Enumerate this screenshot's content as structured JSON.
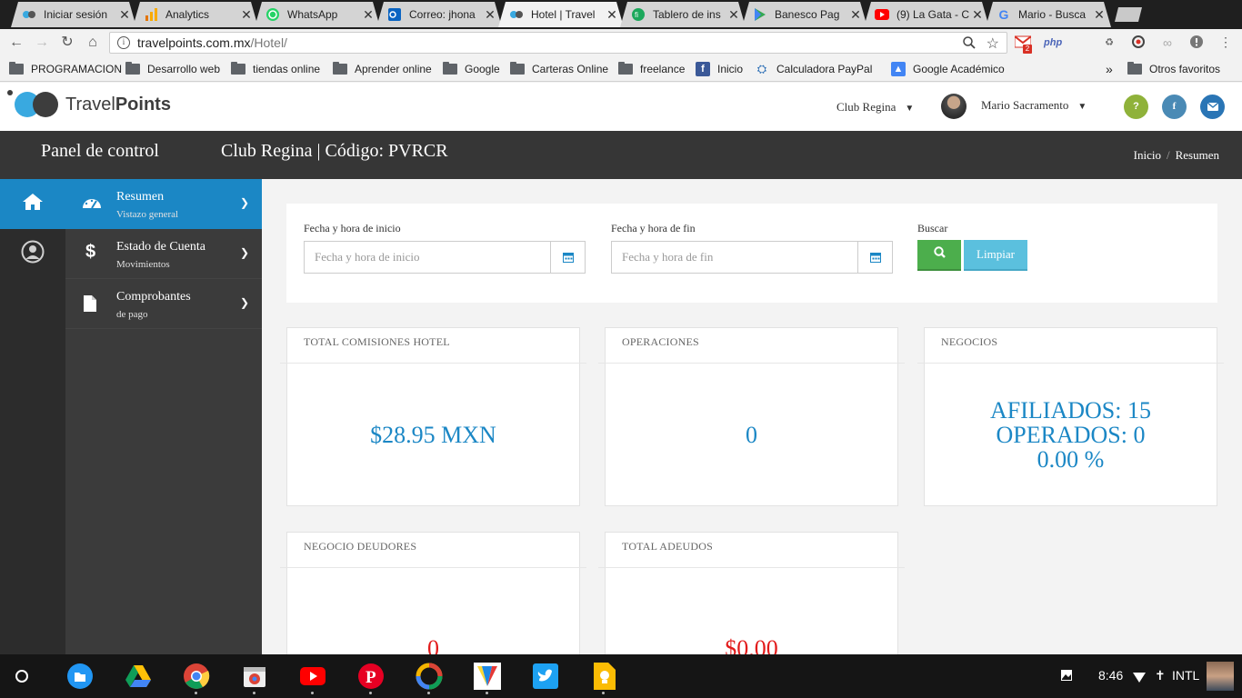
{
  "browser": {
    "tabs": [
      {
        "label": "Iniciar sesión",
        "icon": "travelpoints-icon",
        "active": false
      },
      {
        "label": "Analytics",
        "icon": "analytics-icon",
        "active": false
      },
      {
        "label": "WhatsApp",
        "icon": "whatsapp-icon",
        "active": false
      },
      {
        "label": "Correo: jhona",
        "icon": "outlook-icon",
        "active": false
      },
      {
        "label": "Hotel | Travel",
        "icon": "travelpoints-icon",
        "active": true
      },
      {
        "label": "Tablero de ins",
        "icon": "fi-icon",
        "active": false
      },
      {
        "label": "Banesco Pag",
        "icon": "play-store-icon",
        "active": false
      },
      {
        "label": "(9) La Gata - C",
        "icon": "youtube-icon",
        "active": false
      },
      {
        "label": "Mario - Busca",
        "icon": "google-icon",
        "active": false
      }
    ],
    "url_host": "travelpoints.com.mx",
    "url_path": "/Hotel/",
    "ext_badge": "2",
    "ext_php": "php",
    "bookmarks": [
      {
        "label": "PROGRAMACION",
        "type": "folder"
      },
      {
        "label": "Desarrollo web",
        "type": "folder"
      },
      {
        "label": "tiendas online",
        "type": "folder"
      },
      {
        "label": "Aprender online",
        "type": "folder"
      },
      {
        "label": "Google",
        "type": "folder"
      },
      {
        "label": "Carteras Online",
        "type": "folder"
      },
      {
        "label": "freelance",
        "type": "folder"
      },
      {
        "label": "Inicio",
        "type": "facebook"
      },
      {
        "label": "Calculadora PayPal",
        "type": "link"
      },
      {
        "label": "Google Académico",
        "type": "scholar"
      }
    ],
    "bookmarks_overflow": "»",
    "other_bookmarks": "Otros favoritos"
  },
  "header": {
    "logo_light": "Travel",
    "logo_bold": "Points",
    "club_select": "Club Regina",
    "user_name": "Mario Sacramento",
    "help_label": "?",
    "facebook_label": "f",
    "colors": {
      "help": "#8fb23a",
      "facebook": "#4a8ab5",
      "mail": "#2a75b5"
    }
  },
  "pagebar": {
    "title": "Panel de control",
    "subtitle": "Club Regina | Código: PVRCR",
    "breadcrumb_home": "Inicio",
    "breadcrumb_sep": "/",
    "breadcrumb_current": "Resumen"
  },
  "sidebar": {
    "items": [
      {
        "label": "Resumen",
        "sub": "Vistazo general",
        "active": true
      },
      {
        "label": "Estado de Cuenta",
        "sub": "Movimientos",
        "active": false
      },
      {
        "label": "Comprobantes",
        "sub": "de pago",
        "active": false
      }
    ]
  },
  "filters": {
    "start_label": "Fecha y hora de inicio",
    "start_placeholder": "Fecha y hora de inicio",
    "end_label": "Fecha y hora de fin",
    "end_placeholder": "Fecha y hora de fin",
    "search_label": "Buscar",
    "clear_label": "Limpiar"
  },
  "cards": [
    {
      "title": "TOTAL COMISIONES HOTEL",
      "lines": [
        "$28.95 MXN"
      ],
      "color": "#1b87c5"
    },
    {
      "title": "OPERACIONES",
      "lines": [
        "0"
      ],
      "color": "#1b87c5"
    },
    {
      "title": "NEGOCIOS",
      "lines": [
        "AFILIADOS: 15",
        "OPERADOS: 0",
        "0.00 %"
      ],
      "color": "#1b87c5"
    },
    {
      "title": "NEGOCIO DEUDORES",
      "lines": [
        "0"
      ],
      "color": "#e21b1b"
    },
    {
      "title": "TOTAL ADEUDOS",
      "lines": [
        "$0.00"
      ],
      "color": "#e21b1b"
    }
  ],
  "shelf": {
    "time": "8:46",
    "keyboard": "INTL"
  }
}
